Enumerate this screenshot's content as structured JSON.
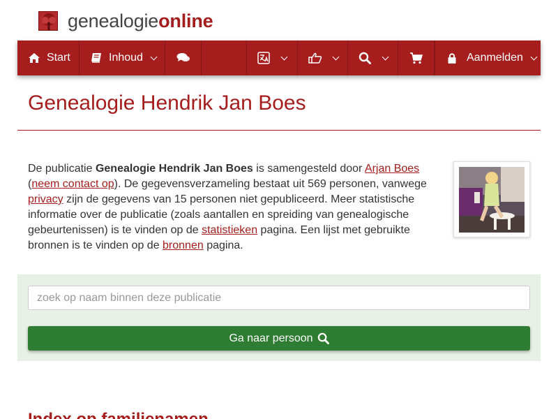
{
  "brand": {
    "name_plain": "genealogie",
    "name_bold": "online",
    "logo_icon": "tree-logo-icon"
  },
  "colors": {
    "brand": "#a51d1d",
    "success": "#2e7d32",
    "panel": "#e8f1e6"
  },
  "nav": {
    "home_label": "Start",
    "home_icon": "home-icon",
    "content_label": "Inhoud",
    "content_icon": "book-icon",
    "chat_icon": "comments-icon",
    "language_icon": "language-icon",
    "like_icon": "thumbs-up-icon",
    "search_icon": "search-icon",
    "cart_icon": "shopping-cart-icon",
    "login_label": "Aanmelden",
    "login_icon": "lock-icon"
  },
  "page": {
    "title": "Genealogie Hendrik Jan Boes"
  },
  "intro": {
    "t1": "De publicatie ",
    "pub_name": "Genealogie Hendrik Jan Boes",
    "t2": " is samengesteld door ",
    "author_link": "Arjan Boes",
    "t3": " (",
    "contact_link": "neem contact op",
    "t4": "). De gegevensverzameling bestaat uit 569 personen, vanwege ",
    "privacy_link": "privacy",
    "t5": " zijn de gegevens van 15 personen niet gepubliceerd. Meer statistische informatie over de publicatie (zoals aantallen en spreiding van genealogische gebeurtenissen) is te vinden op de ",
    "stats_link": "statistieken",
    "t6": " pagina. Een lijst met gebruikte bronnen is te vinden op de ",
    "sources_link": "bronnen",
    "t7": " pagina."
  },
  "search": {
    "placeholder": "zoek op naam binnen deze publicatie",
    "value": "",
    "button_label": "Ga naar persoon",
    "button_icon": "search-icon"
  },
  "section": {
    "heading": "Index op familienamen"
  }
}
